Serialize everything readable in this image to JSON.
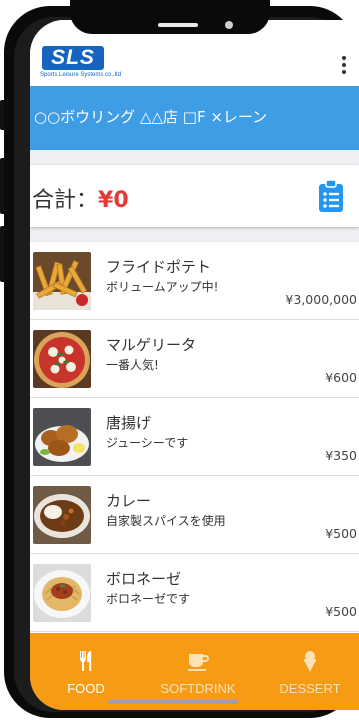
{
  "brand": {
    "logo_text": "SLS",
    "logo_subtext": "Sports Leisure Systems co.,ltd"
  },
  "header": {
    "title": "○○ボウリング △△店 □F ×レーン"
  },
  "total": {
    "label": "合計：",
    "value": "¥0",
    "value_color": "#e53935",
    "icon": "clipboard-list-icon"
  },
  "menu_items": [
    {
      "name": "フライドポテト",
      "desc": "ボリュームアップ中!",
      "price": "¥3,000,000",
      "image": "french-fries-photo"
    },
    {
      "name": "マルゲリータ",
      "desc": "一番人気!",
      "price": "¥600",
      "image": "pizza-photo"
    },
    {
      "name": "唐揚げ",
      "desc": "ジューシーです",
      "price": "¥350",
      "image": "fried-chicken-photo"
    },
    {
      "name": "カレー",
      "desc": "自家製スパイスを使用",
      "price": "¥500",
      "image": "curry-photo"
    },
    {
      "name": "ボロネーゼ",
      "desc": "ボロネーゼです",
      "price": "¥500",
      "image": "bolognese-photo"
    }
  ],
  "tabs": [
    {
      "label": "FOOD",
      "icon": "fork-knife-icon",
      "active": true
    },
    {
      "label": "SOFTDRINK",
      "icon": "coffee-cup-icon",
      "active": false
    },
    {
      "label": "DESSERT",
      "icon": "ice-cream-icon",
      "active": false
    }
  ],
  "colors": {
    "header": "#3f9de6",
    "tabbar": "#f79a14",
    "tab_active": "#ffffff",
    "tab_inactive": "#fde2b5"
  }
}
